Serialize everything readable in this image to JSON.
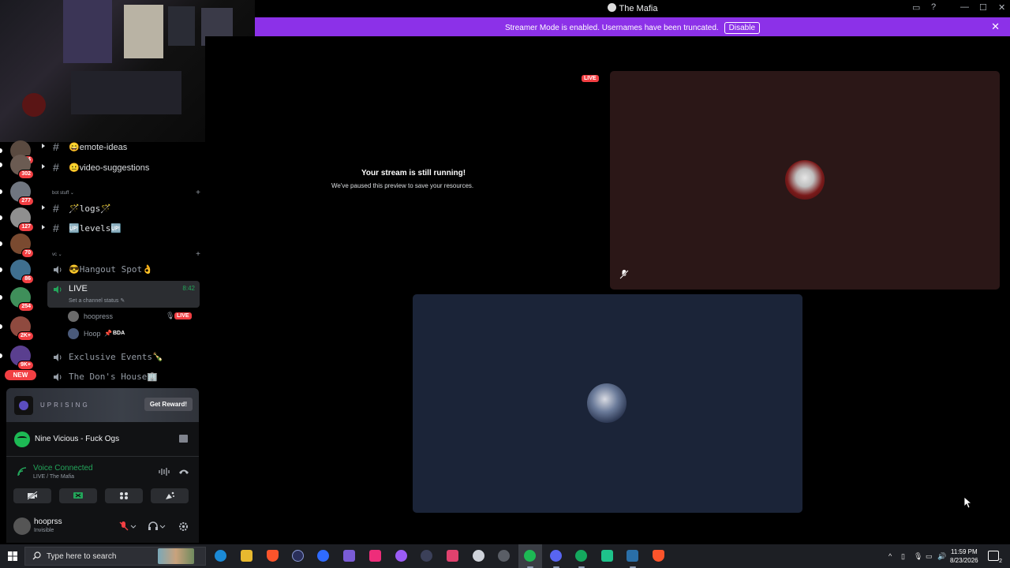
{
  "window": {
    "title": "The Mafia"
  },
  "banner": {
    "message": "Streamer Mode is enabled. Usernames have been truncated.",
    "disable_label": "Disable"
  },
  "servers": [
    {
      "badge": "304"
    },
    {
      "badge": "302"
    },
    {
      "badge": "277"
    },
    {
      "badge": "127"
    },
    {
      "badge": "70"
    },
    {
      "badge": "86"
    },
    {
      "badge": "254"
    },
    {
      "badge": "2K+"
    },
    {
      "badge": "9K+"
    }
  ],
  "servers_new_label": "NEW",
  "channels": {
    "text1": "😄emote-ideas",
    "text2": "😐video-suggestions",
    "category_bot": "bot stuff",
    "logs": "🪄logs🪄",
    "levels": "🆙levels🆙",
    "category_vc": "vc",
    "hangout": "😎Hangout Spot👌",
    "live": {
      "name": "LIVE",
      "timer": "8:42",
      "status": "Set a channel status"
    },
    "members": [
      {
        "name": "hoopress",
        "badge": "LIVE"
      },
      {
        "name": "Hoop",
        "badge": "BDA"
      }
    ],
    "exclusive": "Exclusive Events🍾",
    "dons_house": "The Don's House🏢"
  },
  "promo": {
    "wordmark": "UPRISING",
    "button": "Get Reward!"
  },
  "spotify": {
    "song": "Nine Vicious - Fuck Ogs"
  },
  "voice": {
    "title": "Voice Connected",
    "subtitle": "LIVE / The Mafia"
  },
  "user": {
    "name": "hooprss",
    "status": "Invisible"
  },
  "stage": {
    "paused_title": "Your stream is still running!",
    "paused_subtitle": "We've paused this preview to save your resources.",
    "live_tag": "LIVE"
  },
  "taskbar": {
    "search_placeholder": "Type here to search",
    "time": "11:59 PM",
    "date": "8/23/2026",
    "notifications": "2"
  },
  "colors": {
    "accent": "#8c31e8",
    "live_red": "#f23f43",
    "online_green": "#23a55a",
    "spotify_green": "#1db954"
  }
}
